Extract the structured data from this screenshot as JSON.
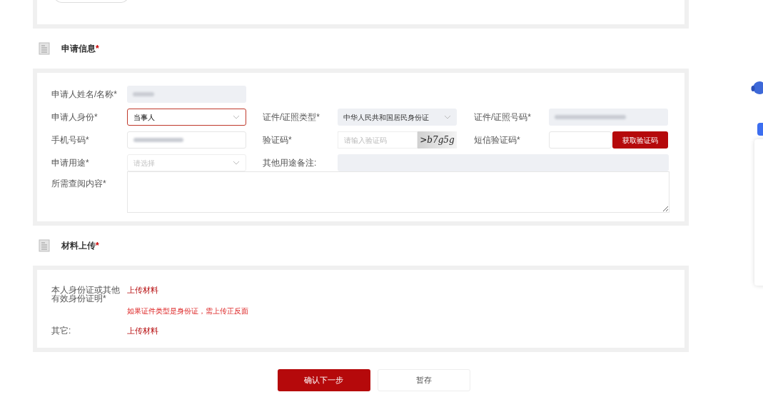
{
  "sections": [
    {
      "title": "申请信息*",
      "kind": "form"
    },
    {
      "title": "材料上传*",
      "kind": "upload"
    }
  ],
  "form": {
    "name": {
      "label": "申请人姓名/名称*"
    },
    "identity": {
      "label": "申请人身份*",
      "value": "当事人",
      "focused": true
    },
    "id_type": {
      "label": "证件/证照类型*",
      "value": "中华人民共和国居民身份证"
    },
    "id_number": {
      "label": "证件/证照号码*"
    },
    "phone": {
      "label": "手机号码*"
    },
    "captcha": {
      "label": "验证码*",
      "placeholder": "请输入验证码",
      "image_text": ">b7g5g"
    },
    "sms": {
      "label": "短信验证码*",
      "button": "获取验证码"
    },
    "purpose": {
      "label": "申请用途*",
      "placeholder": "请选择"
    },
    "purpose_note": {
      "label": "其他用途备注:"
    },
    "content": {
      "label": "所需查阅内容*"
    }
  },
  "uploads": [
    {
      "label": "本人身份证或其他有效身份证明*",
      "link": "上传材料",
      "hint": "如果证件类型是身份证，需上传正反面"
    },
    {
      "label": "其它:",
      "link": "上传材料"
    }
  ],
  "buttons": [
    {
      "label": "确认下一步",
      "primary": true
    },
    {
      "label": "暂存",
      "primary": false
    }
  ]
}
